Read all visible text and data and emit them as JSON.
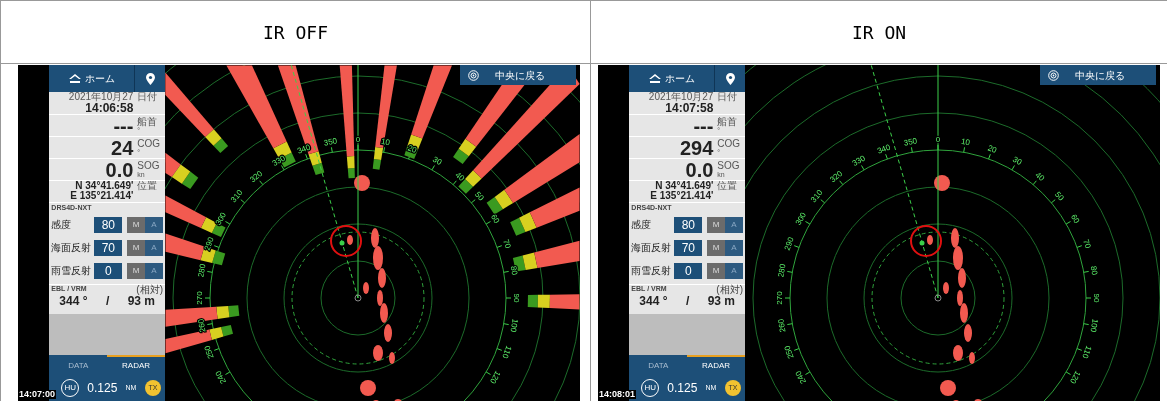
{
  "columns": [
    {
      "header": "IR OFF",
      "screen": {
        "home_button": "ホーム",
        "date": "2021年10月27",
        "time": "14:06:58",
        "date_label": "日付",
        "readouts": [
          {
            "value": "---",
            "label": "船首",
            "unit": "°"
          },
          {
            "value": "24",
            "label": "COG",
            "unit": "°"
          },
          {
            "value": "0.0",
            "label": "SOG",
            "unit": "kn"
          }
        ],
        "position": {
          "lat": "N 34°41.649'",
          "lon": "E 135°21.414'",
          "label": "位置"
        },
        "radar_model": "DRS4D-NXT",
        "gains": [
          {
            "label": "感度",
            "value": "80",
            "modes": [
              {
                "label": "M",
                "selected": true
              },
              {
                "label": "A",
                "selected": false
              }
            ]
          },
          {
            "label": "海面反射",
            "value": "70",
            "modes": [
              {
                "label": "M",
                "selected": true
              },
              {
                "label": "A",
                "selected": false
              }
            ]
          },
          {
            "label": "雨雪反射",
            "value": "0",
            "modes": [
              {
                "label": "M",
                "selected": true
              },
              {
                "label": "A",
                "selected": false
              }
            ]
          }
        ],
        "ebl_vrm": {
          "title": "EBL / VRM",
          "mode": "(相対)",
          "bearing": "344 °",
          "separator": "/",
          "distance": "93 m"
        },
        "tabs": [
          {
            "label": "DATA",
            "selected": false
          },
          {
            "label": "RADAR",
            "selected": true
          }
        ],
        "bottom_bar": {
          "orientation": "HU",
          "range": "0.125",
          "unit": "NM",
          "tx": "TX"
        },
        "clock": "14:07:00",
        "center_button": "中央に戻る",
        "interference_shown": true,
        "bearing_labels": [
          "240",
          "250",
          "260",
          "270",
          "280",
          "290",
          "300",
          "310",
          "320",
          "330",
          "340",
          "350",
          "0",
          "10",
          "20",
          "30",
          "40",
          "50",
          "60",
          "70",
          "80",
          "90",
          "100",
          "110",
          "120"
        ]
      }
    },
    {
      "header": "IR ON",
      "screen": {
        "home_button": "ホーム",
        "date": "2021年10月27",
        "time": "14:07:58",
        "date_label": "日付",
        "readouts": [
          {
            "value": "---",
            "label": "船首",
            "unit": "°"
          },
          {
            "value": "294",
            "label": "COG",
            "unit": "°"
          },
          {
            "value": "0.0",
            "label": "SOG",
            "unit": "kn"
          }
        ],
        "position": {
          "lat": "N 34°41.649'",
          "lon": "E 135°21.414'",
          "label": "位置"
        },
        "radar_model": "DRS4D-NXT",
        "gains": [
          {
            "label": "感度",
            "value": "80",
            "modes": [
              {
                "label": "M",
                "selected": true
              },
              {
                "label": "A",
                "selected": false
              }
            ]
          },
          {
            "label": "海面反射",
            "value": "70",
            "modes": [
              {
                "label": "M",
                "selected": true
              },
              {
                "label": "A",
                "selected": false
              }
            ]
          },
          {
            "label": "雨雪反射",
            "value": "0",
            "modes": [
              {
                "label": "M",
                "selected": true
              },
              {
                "label": "A",
                "selected": false
              }
            ]
          }
        ],
        "ebl_vrm": {
          "title": "EBL / VRM",
          "mode": "(相対)",
          "bearing": "344 °",
          "separator": "/",
          "distance": "93 m"
        },
        "tabs": [
          {
            "label": "DATA",
            "selected": false
          },
          {
            "label": "RADAR",
            "selected": true
          }
        ],
        "bottom_bar": {
          "orientation": "HU",
          "range": "0.125",
          "unit": "NM",
          "tx": "TX"
        },
        "clock": "14:08:01",
        "center_button": "中央に戻る",
        "interference_shown": false,
        "bearing_labels": [
          "240",
          "250",
          "260",
          "270",
          "280",
          "290",
          "300",
          "310",
          "320",
          "330",
          "340",
          "350",
          "0",
          "10",
          "20",
          "30",
          "40",
          "50",
          "60",
          "70",
          "80",
          "90",
          "100",
          "110",
          "120"
        ]
      }
    }
  ]
}
